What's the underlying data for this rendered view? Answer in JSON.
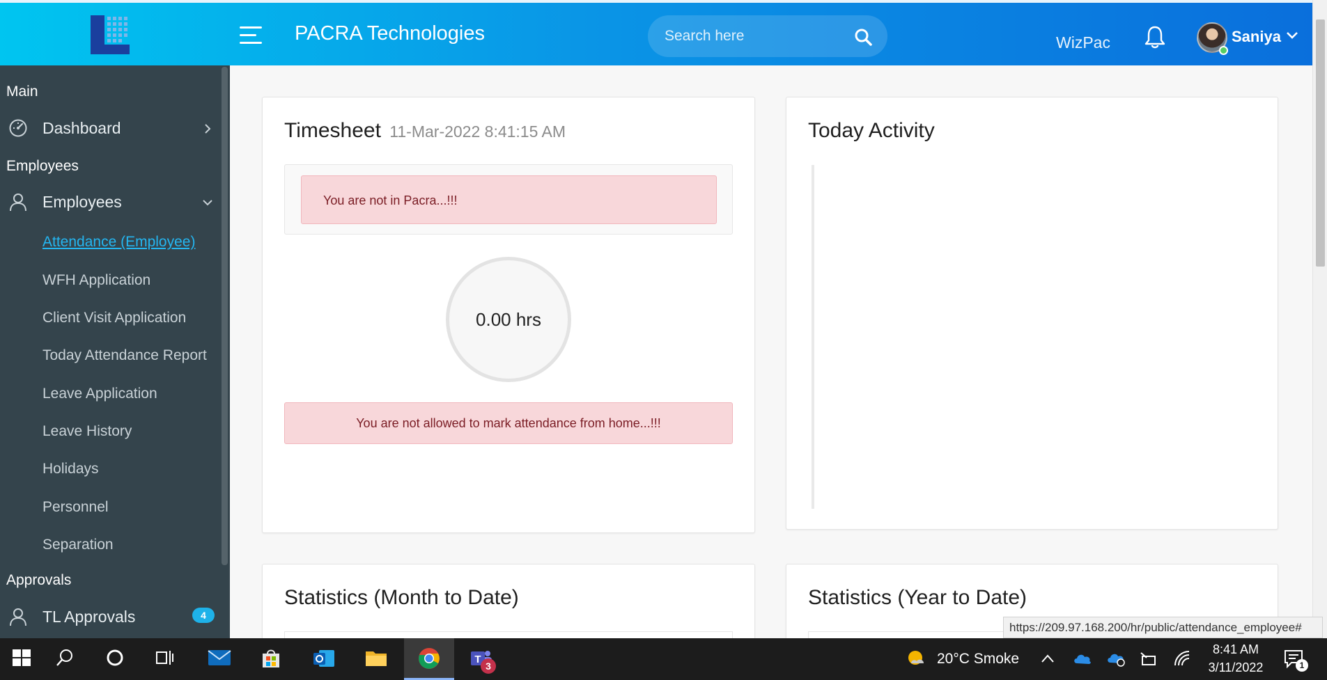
{
  "header": {
    "app_title": "PACRA Technologies",
    "search_placeholder": "Search here",
    "brand_link": "WizPac",
    "user_name": "Saniya",
    "accent_color": "#0a95e6"
  },
  "sidebar": {
    "sections": {
      "main": "Main",
      "employees": "Employees",
      "approvals": "Approvals"
    },
    "items": {
      "dashboard": "Dashboard",
      "employees": "Employees",
      "tl_approvals": "TL Approvals",
      "tl_approvals_badge": "4"
    },
    "sub_items": [
      "Attendance (Employee)",
      "WFH Application",
      "Client Visit Application",
      "Today Attendance Report",
      "Leave Application",
      "Leave History",
      "Holidays",
      "Personnel",
      "Separation"
    ],
    "active_sub_item": "Attendance (Employee)"
  },
  "timesheet": {
    "title": "Timesheet",
    "datetime": "11-Mar-2022 8:41:15 AM",
    "alert_location": "You are not in Pacra...!!!",
    "hours": "0.00 hrs",
    "hours_value": 0.0,
    "alert_wfh": "You are not allowed to mark attendance from home...!!!"
  },
  "today_activity": {
    "title": "Today Activity"
  },
  "statistics": {
    "month_title": "Statistics (Month to Date)",
    "year_title": "Statistics (Year to Date)"
  },
  "status_url": "https://209.97.168.200/hr/public/attendance_employee#",
  "taskbar": {
    "weather": "20°C  Smoke",
    "time": "8:41 AM",
    "date": "3/11/2022",
    "teams_badge": "3",
    "notification_badge": "1"
  }
}
